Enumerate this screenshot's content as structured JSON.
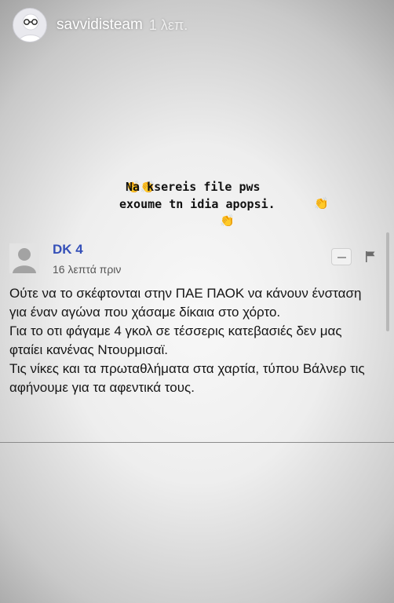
{
  "story": {
    "username": "savvidisteam",
    "time": "1 λεπ."
  },
  "caption": {
    "line1": "Na ksereis file pws",
    "line2": "exoume tn idia apopsi.",
    "emoji": "👏"
  },
  "comment": {
    "author": "DK 4",
    "time": "16 λεπτά πριν",
    "paragraphs": [
      "Ούτε να το σκέφτονται στην ΠΑΕ ΠΑΟΚ να κάνουν ένσταση για έναν αγώνα που χάσαμε δίκαια στο χόρτο.",
      "Για το οτι φάγαμε 4 γκολ σε τέσσερις κατεβασιές δεν μας φταίει κανένας Ντουρμισαϊ.",
      "Τις νίκες και τα πρωταθλήματα στα χαρτία, τύπου Βάλνερ τις αφήνουμε για τα αφεντικά τους."
    ]
  },
  "icons": {
    "avatar": "glasses-avatar-icon",
    "comment_avatar": "user-silhouette-icon",
    "collapse": "minus-icon",
    "flag": "flag-icon"
  },
  "colors": {
    "author": "#3550b8",
    "emoji": "#e7b43a"
  }
}
